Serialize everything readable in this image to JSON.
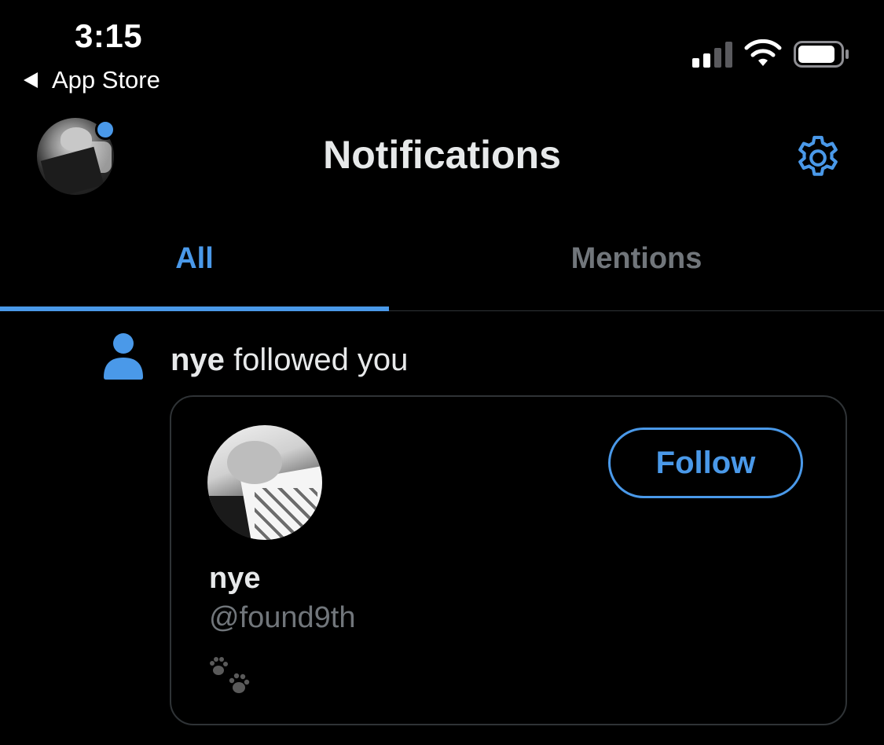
{
  "status_bar": {
    "time": "3:15",
    "back_app": "App Store",
    "icons": [
      "cellular-signal-icon",
      "wifi-icon",
      "battery-icon"
    ]
  },
  "header": {
    "title": "Notifications",
    "avatar_icon": "profile-avatar",
    "settings_icon": "gear-icon"
  },
  "tabs": [
    {
      "label": "All",
      "active": true
    },
    {
      "label": "Mentions",
      "active": false
    }
  ],
  "notification": {
    "icon": "person-icon",
    "actor": "nye",
    "action": "followed you",
    "card": {
      "name": "nye",
      "handle": "@found9th",
      "bio_icon": "paw-prints-icon",
      "follow_label": "Follow"
    }
  },
  "colors": {
    "accent": "#4a99e9",
    "background": "#000000",
    "text": "#e7e9ea",
    "muted": "#71767b",
    "border": "#2f3336"
  }
}
